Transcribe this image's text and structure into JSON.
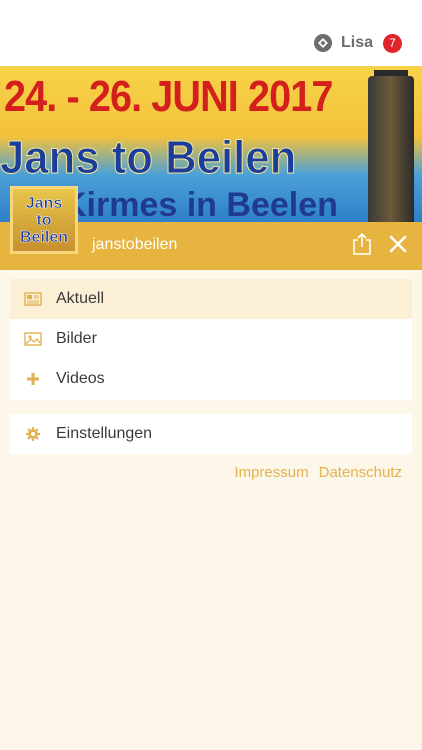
{
  "topbar": {
    "user_name": "Lisa",
    "notification_count": "7"
  },
  "banner": {
    "date_text": "24. - 26. JUNI 2017",
    "title_text": "Jans to Beilen",
    "subtitle_text": "Kirmes in Beelen"
  },
  "profile": {
    "avatar_line1": "Jans",
    "avatar_line2": "to",
    "avatar_line3": "Beilen",
    "name": "janstobeilen"
  },
  "menu": {
    "items": [
      {
        "label": "Aktuell",
        "icon": "newspaper-icon"
      },
      {
        "label": "Bilder",
        "icon": "image-icon"
      },
      {
        "label": "Videos",
        "icon": "plus-icon"
      }
    ],
    "settings_label": "Einstellungen",
    "settings_icon": "gear-icon"
  },
  "footer": {
    "impressum": "Impressum",
    "datenschutz": "Datenschutz"
  },
  "colors": {
    "accent": "#e6b43f",
    "badge": "#e0252a",
    "link": "#e2b251",
    "background": "#fdf7ea"
  }
}
